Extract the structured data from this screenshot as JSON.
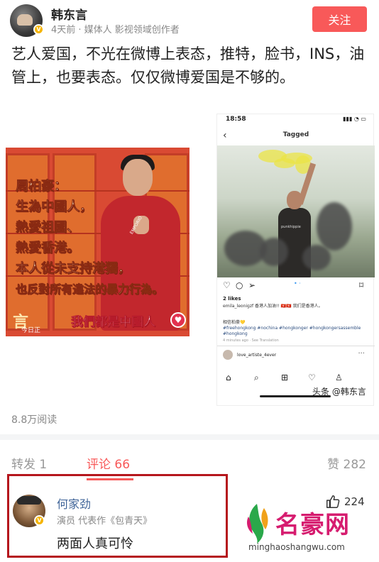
{
  "author": {
    "name": "韩东言",
    "meta": "4天前 · 媒体人 影视领域创作者",
    "verified_badge": "V",
    "follow_label": "关注"
  },
  "post": {
    "text": "艺人爱国，不光在微博上表态，推特，脸书，INS，油管上，也要表态。仅仅微博爱国是不够的。"
  },
  "image_left": {
    "lines": [
      "周柏豪：",
      "生為中國人，",
      "熱愛祖國、",
      "熱愛香港。",
      "本人從未支持港獨，",
      "也反對所有違法的暴力行為。"
    ],
    "logo": "言",
    "logo_sub": "今日正",
    "slogan": "我們都是中國人",
    "shirt_text": "EMPORIO"
  },
  "image_right": {
    "status_time": "18:58",
    "status_icons": "▮▮▮ ◔ ▭",
    "title": "Tagged",
    "shirt_text": "punkhippie",
    "likes": "2 likes",
    "caption": "emila_leonigzf 香港人加油!! 🇭🇰🇭🇰 我们是香港人。",
    "caption2": "相信柏豪💛",
    "tags": "#freehongkong #nochina #hongkonger #hongkongersassemble #hongkong",
    "time": "4 minutes ago · See Translation",
    "comment_user": "love_artiste_4ever",
    "more": "···"
  },
  "watermark": "头条 @韩东言",
  "stats": {
    "read_count": "8.8万阅读"
  },
  "tabs": {
    "repost": "转发 1",
    "comment": "评论 66",
    "like": "赞 282"
  },
  "comment": {
    "name": "何家劲",
    "meta": "演员 代表作《包青天》",
    "text": "两面人真可怜",
    "like_count": "224",
    "verified_badge": "V"
  },
  "site": {
    "name": "名豪网",
    "url": "minghaoshangwu.com"
  },
  "colors": {
    "accent": "#f85959",
    "highlight_border": "#b5161d",
    "site_brand": "#d61c6f"
  }
}
